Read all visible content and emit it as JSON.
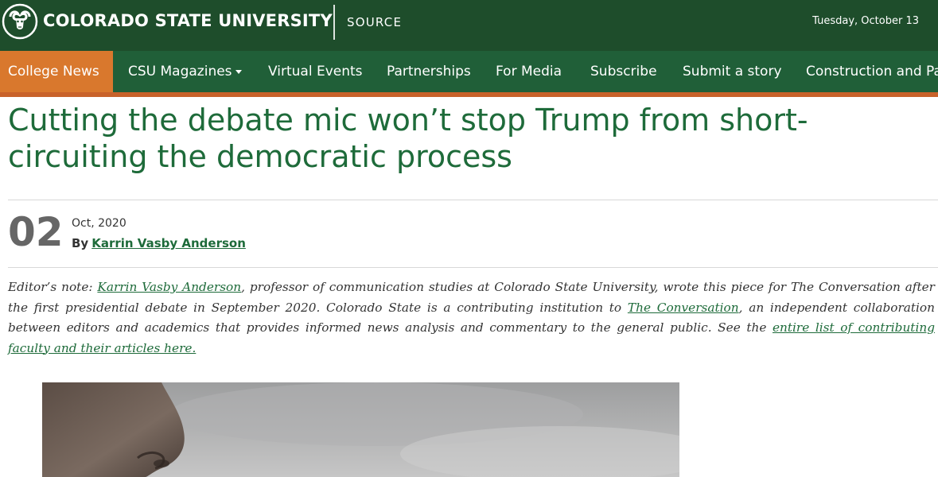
{
  "header": {
    "brand": "COLORADO STATE UNIVERSITY",
    "section": "SOURCE",
    "date": "Tuesday, October 13",
    "logo_icon": "ram-head-logo-icon",
    "brand_color": "#1e4d2b"
  },
  "nav": {
    "items": [
      {
        "label": "College News",
        "active": true
      },
      {
        "label": "CSU Magazines",
        "has_dropdown": true
      },
      {
        "label": "Virtual Events"
      },
      {
        "label": "Partnerships"
      },
      {
        "label": "For Media"
      },
      {
        "label": "Subscribe"
      },
      {
        "label": "Submit a story"
      },
      {
        "label": "Construction and Pa"
      }
    ],
    "bar_color": "#205f38",
    "active_color": "#d9782d",
    "accent_color": "#c8622a"
  },
  "article": {
    "title": "Cutting the debate mic won’t stop Trump from short-circuiting the democratic process",
    "day": "02",
    "month_year": "Oct, 2020",
    "by_label": "By",
    "author": "Karrin Vasby Anderson",
    "editors_note": {
      "label": "Editor’s note:",
      "author_link": "Karrin Vasby Anderson",
      "text1": ", professor of communication studies at Colorado State University, wrote this piece for The Conversation after the first presidential debate in September 2020. Colorado State is a contributing institution to ",
      "conversation_link": "The Conversation",
      "text2": ", an independent collaboration between editors and academics that provides informed news analysis and commentary to the general public. See the ",
      "list_link": "entire list of contributing faculty and their articles here."
    },
    "title_color": "#1e6b3a"
  }
}
